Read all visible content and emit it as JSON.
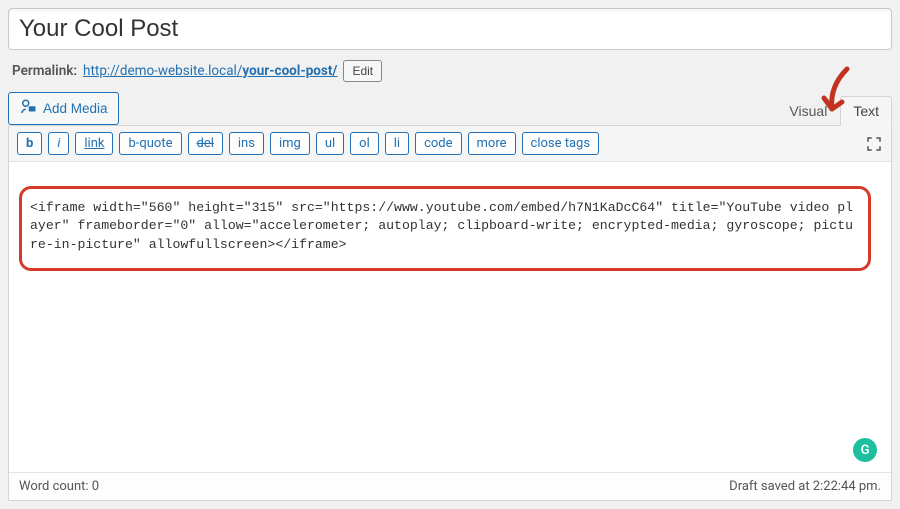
{
  "title": {
    "value": "Your Cool Post"
  },
  "permalink": {
    "label": "Permalink:",
    "base": "http://demo-website.local/",
    "slug": "your-cool-post/",
    "edit": "Edit"
  },
  "media_button": "Add Media",
  "tabs": {
    "visual": "Visual",
    "text": "Text"
  },
  "quicktags": {
    "b": "b",
    "i": "i",
    "link": "link",
    "bquote": "b-quote",
    "del": "del",
    "ins": "ins",
    "img": "img",
    "ul": "ul",
    "ol": "ol",
    "li": "li",
    "code": "code",
    "more": "more",
    "close": "close tags"
  },
  "editor_content": "<iframe width=\"560\" height=\"315\" src=\"https://www.youtube.com/embed/h7N1KaDcC64\" title=\"YouTube video player\" frameborder=\"0\" allow=\"accelerometer; autoplay; clipboard-write; encrypted-media; gyroscope; picture-in-picture\" allowfullscreen></iframe>",
  "grammarly_letter": "G",
  "status": {
    "wordcount_label": "Word count: ",
    "wordcount": "0",
    "autosave": "Draft saved at 2:22:44 pm."
  },
  "colors": {
    "accent": "#2371b1",
    "highlight_border": "#d63a2a",
    "arrow": "#c3311f"
  }
}
